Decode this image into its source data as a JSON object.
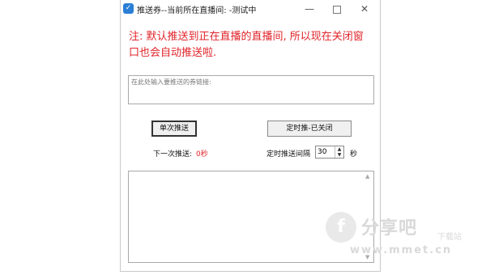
{
  "window": {
    "title": "推送券--当前所在直播间: -测试中",
    "icon": "app-icon",
    "minimize": "—",
    "close": "✕"
  },
  "notice": "注: 默认推送到正在直播的直播间, 所以现在关闭窗口也会自动推送啦.",
  "link_input": {
    "placeholder": "在此处输入要推送的券链接:"
  },
  "buttons": {
    "single_push": "单次推送",
    "timer_push": "定时推-已关闭"
  },
  "next_push": {
    "label": "下一次推送:",
    "value": "0秒"
  },
  "interval": {
    "label": "定时推送间隔",
    "value": "30",
    "unit": "秒"
  },
  "watermark": {
    "logo": "f",
    "text": "分享吧",
    "sub": "下载站",
    "url": "www.mmet.cn"
  },
  "colors": {
    "notice": "#e0242a",
    "accent": "#2b7fd6"
  }
}
